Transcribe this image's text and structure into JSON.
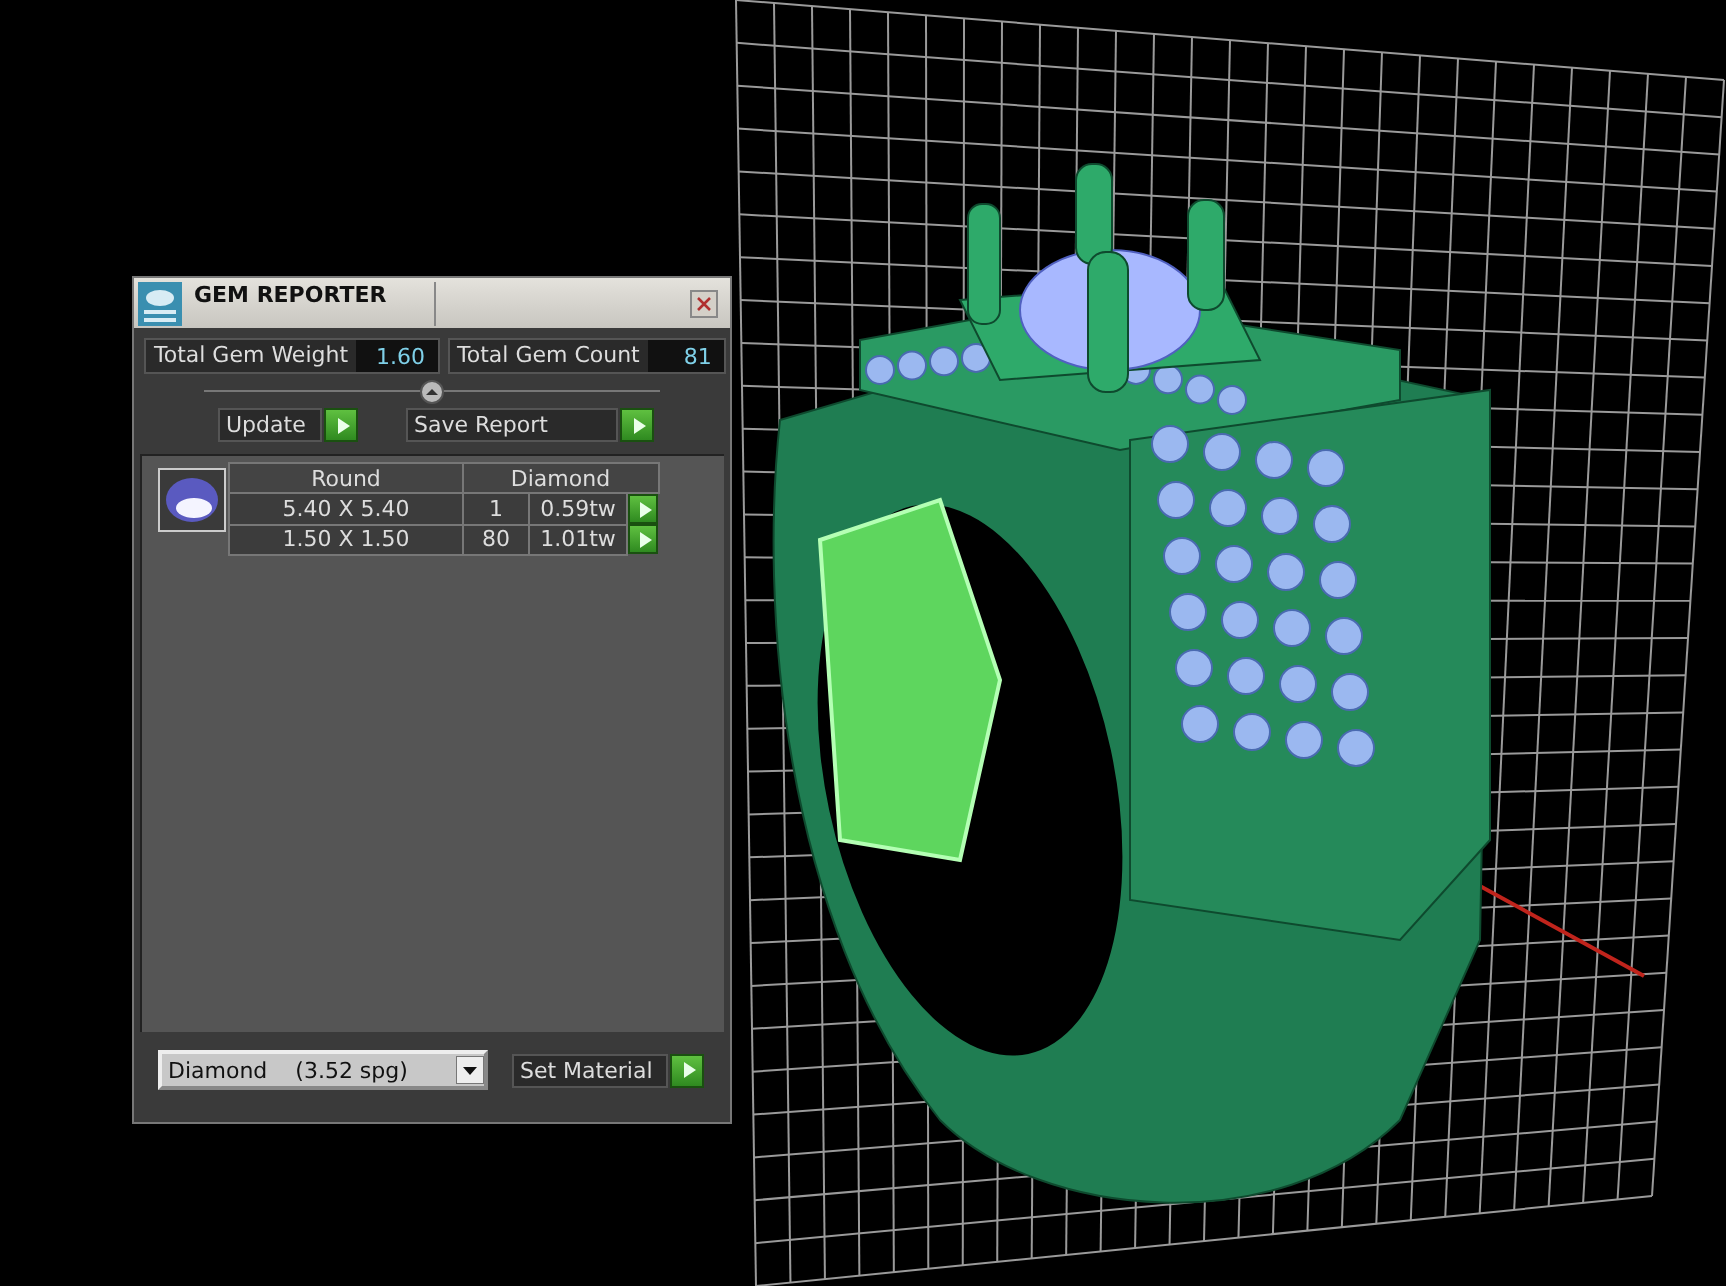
{
  "panel": {
    "title": "GEM REPORTER",
    "stats": [
      {
        "label": "Total Gem Weight",
        "value": "1.60"
      },
      {
        "label": "Total Gem Count",
        "value": "81"
      }
    ],
    "buttons": [
      "Update",
      "Save Report"
    ],
    "table": {
      "columns": [
        "Round",
        "Diamond"
      ],
      "rows": [
        {
          "size": "5.40 X 5.40",
          "count": "1",
          "weight": "0.59tw"
        },
        {
          "size": "1.50 X 1.50",
          "count": "80",
          "weight": "1.01tw"
        }
      ]
    },
    "material": {
      "value": "Diamond    (3.52 spg)",
      "button": "Set Material"
    }
  }
}
